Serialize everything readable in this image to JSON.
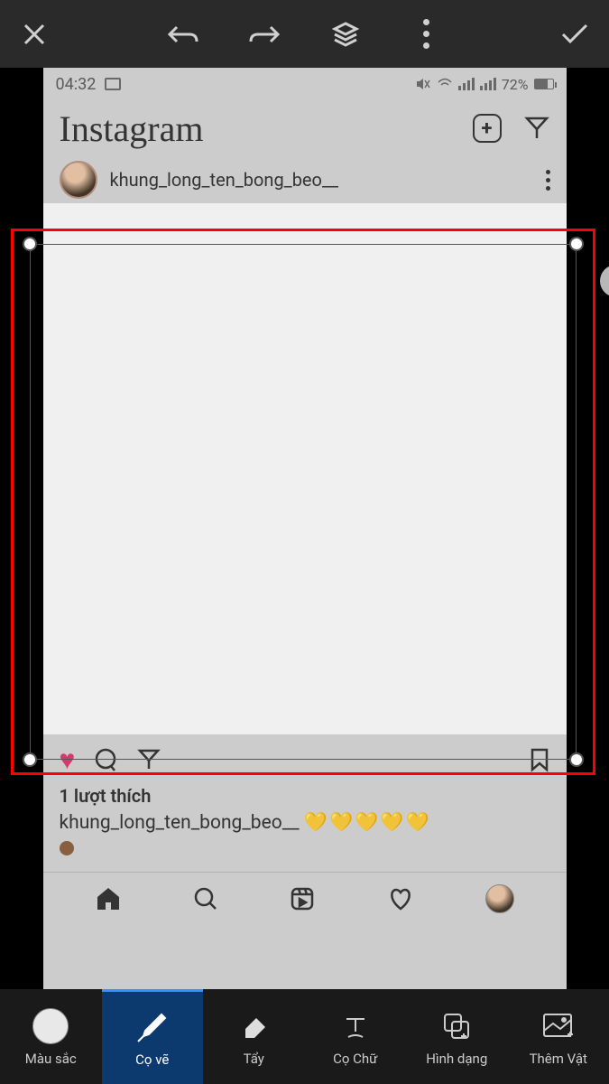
{
  "status": {
    "time": "04:32",
    "battery_pct": "72%"
  },
  "instagram": {
    "logo_text": "Instagram",
    "post_username": "khung_long_ten_bong_beo__",
    "likes_text": "1 lượt thích",
    "caption_user": "khung_long_ten_bong_beo__",
    "caption_hearts": "💛💛💛💛💛"
  },
  "editor_tools": {
    "color": "Màu sắc",
    "brush": "Cọ vẽ",
    "eraser": "Tẩy",
    "text_brush": "Cọ Chữ",
    "shape": "Hình dạng",
    "add_object": "Thêm Vật"
  }
}
